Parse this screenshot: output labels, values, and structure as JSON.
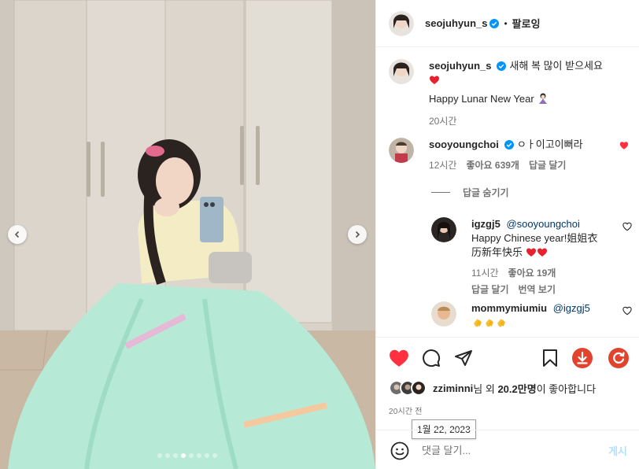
{
  "header": {
    "username": "seojuhyun_s",
    "separator": "•",
    "follow_label": "팔로잉"
  },
  "caption": {
    "username": "seojuhyun_s",
    "line1": "새해 복 많이 받으세요",
    "line2": "Happy Lunar New Year",
    "time": "20시간"
  },
  "comments": [
    {
      "username": "sooyoungchoi",
      "text": "ㅇㅏ이고이뻐라",
      "time": "12시간",
      "likes": "좋아요 639개",
      "reply_label": "답글 달기",
      "liked": true
    }
  ],
  "hide_replies_label": "답글 숨기기",
  "replies": [
    {
      "username": "igzgj5",
      "mention": "@sooyoungchoi",
      "text1": "Happy Chinese year!姐姐衣",
      "text2": "历新年快乐",
      "time": "11시간",
      "likes": "좋아요 19개",
      "reply_label": "답글 달기",
      "translate_label": "번역 보기"
    },
    {
      "username": "mommymiumiu",
      "mention": "@igzgj5"
    }
  ],
  "likes_line": {
    "user": "zziminni",
    "middle": "님 외",
    "count": "20.2만명",
    "suffix": "이 좋아합니다"
  },
  "post_time": "20시간 전",
  "tooltip_date": "1월 22, 2023",
  "composer": {
    "placeholder": "댓글 달기...",
    "post_label": "게시"
  },
  "icons": {
    "like": "heart-filled-icon",
    "comment": "comment-icon",
    "share": "share-icon",
    "save": "bookmark-icon",
    "download": "download-icon",
    "refresh": "refresh-icon"
  },
  "colors": {
    "like_red": "#ff3040",
    "verified_blue": "#0095f6",
    "download_red": "#e0442e",
    "refresh_red": "#e0442e"
  },
  "carousel": {
    "count": 8,
    "active_index": 3
  }
}
